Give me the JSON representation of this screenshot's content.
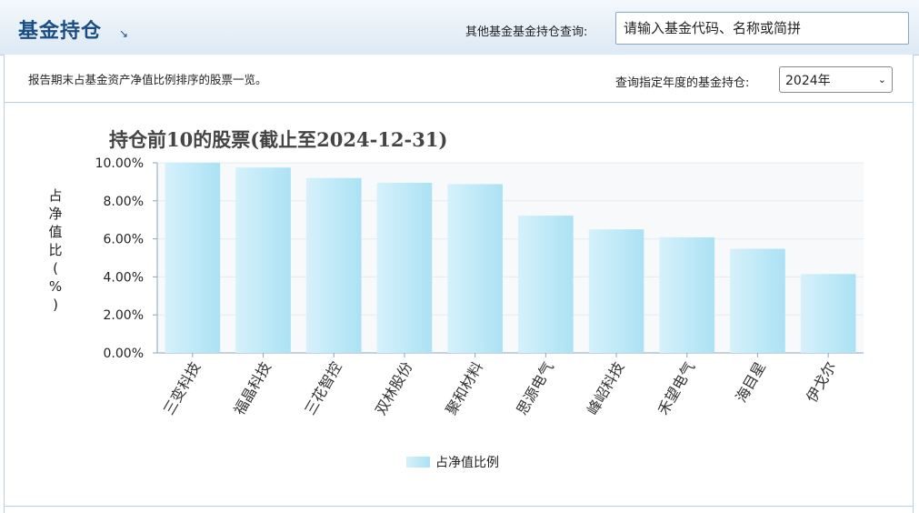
{
  "header": {
    "title": "基金持仓",
    "search_label": "其他基金基金持仓查询:",
    "search_placeholder": "请输入基金代码、名称或简拼"
  },
  "subbar": {
    "description": "报告期末占基金资产净值比例排序的股票一览。",
    "year_label": "查询指定年度的基金持仓:",
    "year_value": "2024年"
  },
  "chart_data": {
    "type": "bar",
    "title": "持仓前10的股票(截止至2024-12-31)",
    "ylabel": "占净值比(%)",
    "xlabel": "",
    "categories": [
      "三变科技",
      "福晶科技",
      "三花智控",
      "双林股份",
      "聚和材料",
      "思源电气",
      "峰岹科技",
      "禾望电气",
      "海目星",
      "伊戈尔"
    ],
    "series": [
      {
        "name": "占净值比例",
        "values": [
          10.0,
          9.75,
          9.2,
          8.95,
          8.88,
          7.22,
          6.5,
          6.08,
          5.48,
          4.15
        ]
      }
    ],
    "yticks": [
      "0.00%",
      "2.00%",
      "4.00%",
      "6.00%",
      "8.00%",
      "10.00%"
    ],
    "ylim": [
      0,
      10
    ],
    "grid": true,
    "legend": "bottom-center",
    "colors": {
      "bar_light": "#d6f1fb",
      "bar_dark": "#abe2f4",
      "grid": "#e3ecf2",
      "plot_bg": "#f7f9fb",
      "axis": "#8aa6c0"
    }
  }
}
